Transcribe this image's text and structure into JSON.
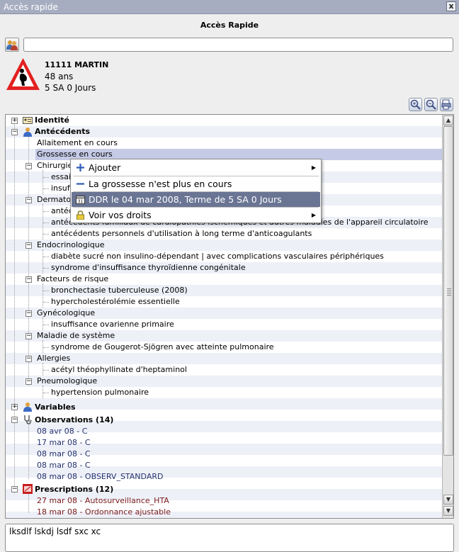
{
  "window": {
    "title": "Accès rapide",
    "close": "x"
  },
  "heading": "Accès Rapide",
  "search": {
    "value": "",
    "placeholder": ""
  },
  "patient": {
    "name": "11111 MARTIN",
    "age": "48 ans",
    "term": "5 SA 0 Jours"
  },
  "tree": {
    "identite": "Identité",
    "antecedents": "Antécédents",
    "allaitement": "Allaitement en cours",
    "grossesse": "Grossesse en cours",
    "chirurgie": "Chirurgie",
    "chir1": "essai",
    "chir2": "insuffisance",
    "dermato": "Dermatologie",
    "derm1": "antécédents",
    "derm2": "antécédents familiaux de cardiopathies ischémiques et autres maladies de l'appareil circulatoire",
    "derm3": "antécédents personnels d'utilisation  à long terme d'anticoagulants",
    "endocrino": "Endocrinologique",
    "endo1": "diabète sucré non insulino-dépendant | avec complications vasculaires périphériques",
    "endo2": "syndrome d'insuffisance thyroïdienne congénitale",
    "facteurs": "Facteurs de risque",
    "fact1": "bronchectasie tuberculeuse (2008)",
    "fact2": "hypercholestérolémie essentielle",
    "gyneco": "Gynécologique",
    "gyn1": "insuffisance ovarienne primaire",
    "maladie": "Maladie de système",
    "mal1": "syndrome de Gougerot-Sjögren avec atteinte pulmonaire",
    "allergies": "Allergies",
    "all1": "acétyl théophyllinate d'heptaminol",
    "pneumo": "Pneumologique",
    "pneu1": "hypertension  pulmonaire",
    "variables": "Variables",
    "observations": "Observations (14)",
    "obs": [
      "08 avr 08 - C",
      "17 mar 08 - C",
      "08 mar 08 - C",
      "08 mar 08 - C",
      "08 mar 08 - OBSERV_STANDARD"
    ],
    "prescriptions": "Prescriptions (12)",
    "presc": [
      "27 mar 08 - Autosurveillance_HTA",
      "18 mar 08 - Ordonnance ajustable"
    ]
  },
  "context_menu": {
    "add": "Ajouter",
    "end": "La grossesse n'est plus en cours",
    "ddr": "DDR le 04 mar 2008, Terme de 5 SA 0 Jours",
    "calendar_day": "31",
    "rights": "Voir vos droits"
  },
  "notes": "lksdlf lskdj lsdf sxc xc"
}
